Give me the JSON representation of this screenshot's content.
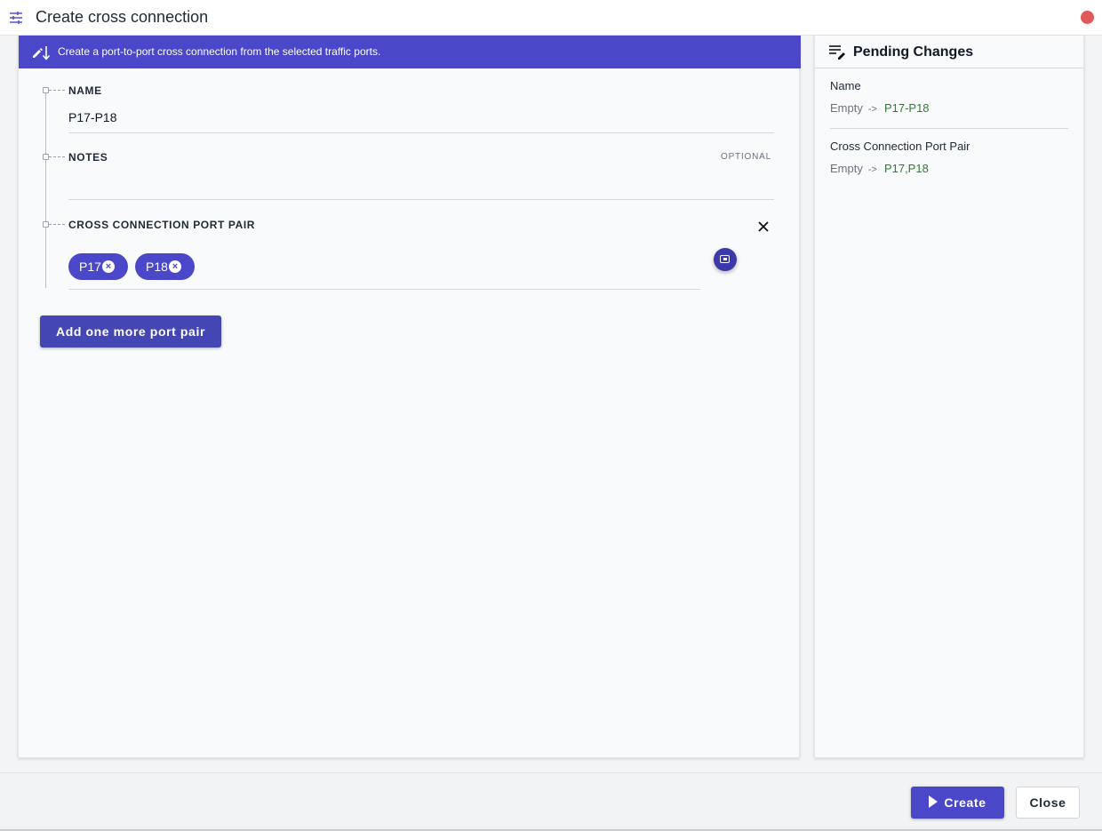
{
  "window": {
    "title": "Create cross connection",
    "title_icon": "tune-icon",
    "record_indicator_color": "#e05a5a"
  },
  "banner": {
    "text": "Create a port-to-port cross connection from the selected traffic ports.",
    "icon": "edit-sort-icon",
    "color": "#4a47c9"
  },
  "form": {
    "name": {
      "label": "NAME",
      "value": "P17-P18"
    },
    "notes": {
      "label": "NOTES",
      "value": "",
      "tag": "OPTIONAL"
    },
    "port_pair": {
      "label": "CROSS CONNECTION PORT PAIR",
      "chips": [
        "P17",
        "P18"
      ]
    },
    "add_button_label": "Add one more port pair"
  },
  "pending": {
    "title": "Pending Changes",
    "changes": [
      {
        "label": "Name",
        "old": "Empty",
        "arrow": "->",
        "new": "P17-P18"
      },
      {
        "label": "Cross Connection Port Pair",
        "old": "Empty",
        "arrow": "->",
        "new": "P17,P18"
      }
    ]
  },
  "footer": {
    "create_label": "Create",
    "close_label": "Close"
  }
}
